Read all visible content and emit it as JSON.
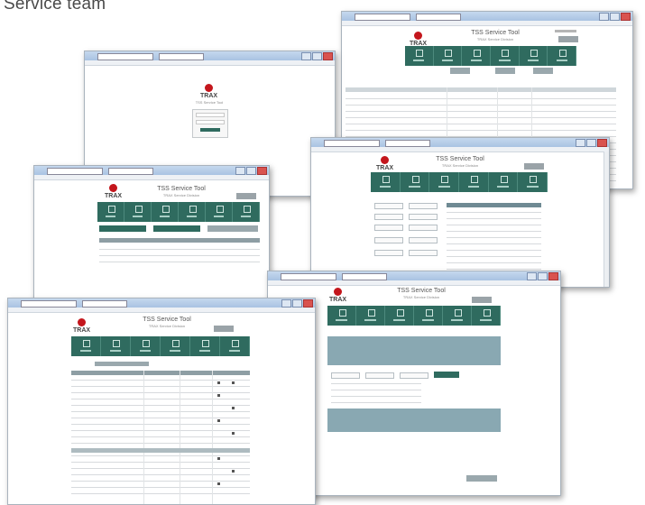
{
  "caption": "Service team",
  "logo": {
    "text": "TRAX"
  },
  "app": {
    "title": "TSS Service Tool",
    "subtitle": "TRAX Service Division"
  },
  "windows": [
    {
      "name": "inventory-grid-window"
    },
    {
      "name": "login-window"
    },
    {
      "name": "service-form-window"
    },
    {
      "name": "dashboard-window"
    },
    {
      "name": "report-window"
    },
    {
      "name": "checklist-window"
    }
  ],
  "colors": {
    "nav": "#2f6b5f",
    "header": "#89a8b2",
    "logo": "#c4161c"
  }
}
